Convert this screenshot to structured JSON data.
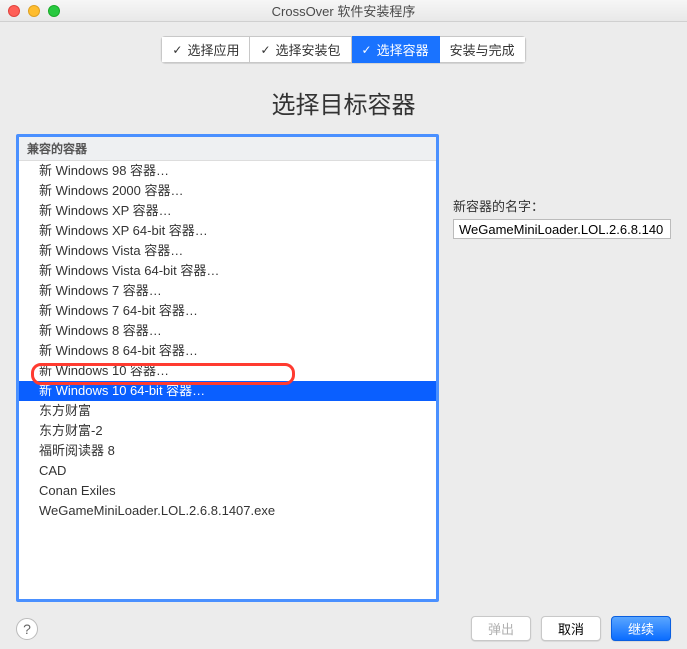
{
  "window": {
    "title": "CrossOver 软件安装程序"
  },
  "steps": [
    {
      "label": "选择应用",
      "active": false,
      "done": true
    },
    {
      "label": "选择安装包",
      "active": false,
      "done": true
    },
    {
      "label": "选择容器",
      "active": true,
      "done": true
    },
    {
      "label": "安装与完成",
      "active": false,
      "done": false
    }
  ],
  "heading": "选择目标容器",
  "list": {
    "section": "兼容的容器",
    "items": [
      "新 Windows 98 容器…",
      "新 Windows 2000 容器…",
      "新 Windows XP 容器…",
      "新 Windows XP 64-bit 容器…",
      "新 Windows Vista 容器…",
      "新 Windows Vista 64-bit 容器…",
      "新 Windows 7 容器…",
      "新 Windows 7 64-bit 容器…",
      "新 Windows 8 容器…",
      "新 Windows 8 64-bit 容器…",
      "新 Windows 10 容器…",
      "新 Windows 10 64-bit 容器…",
      "东方财富",
      "东方财富-2",
      "福昕阅读器 8",
      "CAD",
      "Conan Exiles",
      "WeGameMiniLoader.LOL.2.6.8.1407.exe"
    ],
    "selectedIndex": 11
  },
  "right": {
    "label": "新容器的名字：",
    "value": "WeGameMiniLoader.LOL.2.6.8.140"
  },
  "footer": {
    "help": "?",
    "eject": "弹出",
    "cancel": "取消",
    "continue": "继续"
  }
}
